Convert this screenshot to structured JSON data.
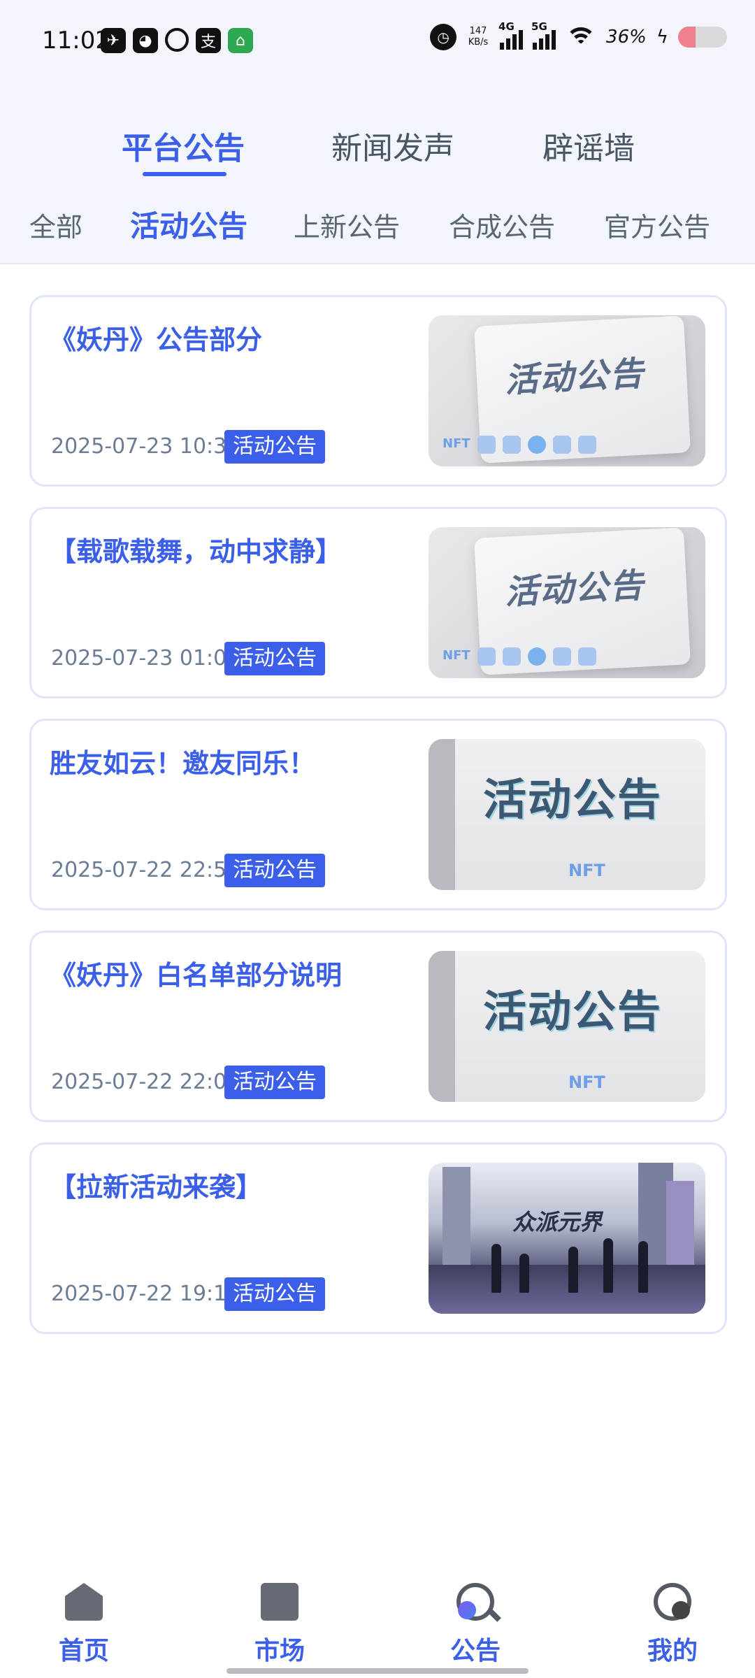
{
  "status_bar": {
    "time": "11:02",
    "app_icons": [
      "telegram-icon",
      "weibo-icon",
      "q-icon",
      "alipay-icon",
      "home-app-icon"
    ],
    "net_speed_value": "147",
    "net_speed_unit": "KB/s",
    "signal_labels": [
      "4G",
      "5G"
    ],
    "battery_text": "36%",
    "battery_level": 0.36
  },
  "main_tabs": [
    {
      "label": "平台公告",
      "active": true
    },
    {
      "label": "新闻发声",
      "active": false
    },
    {
      "label": "辟谣墙",
      "active": false
    }
  ],
  "sub_tabs": [
    {
      "label": "全部",
      "active": false
    },
    {
      "label": "活动公告",
      "active": true
    },
    {
      "label": "上新公告",
      "active": false
    },
    {
      "label": "合成公告",
      "active": false
    },
    {
      "label": "官方公告",
      "active": false
    }
  ],
  "announcements": [
    {
      "title": "《妖丹》公告部分",
      "date": "2025-07-23 10:30",
      "tag": "活动公告",
      "thumb_text": "活动公告",
      "thumb_nft": "NFT"
    },
    {
      "title": "【载歌载舞，动中求静】",
      "date": "2025-07-23 01:09",
      "tag": "活动公告",
      "thumb_text": "活动公告",
      "thumb_nft": "NFT"
    },
    {
      "title": "胜友如云！邀友同乐！",
      "date": "2025-07-22 22:53",
      "tag": "活动公告",
      "thumb_text": "活动公告",
      "thumb_nft": "NFT"
    },
    {
      "title": "《妖丹》白名单部分说明",
      "date": "2025-07-22 22:02",
      "tag": "活动公告",
      "thumb_text": "活动公告",
      "thumb_nft": "NFT"
    },
    {
      "title": "【拉新活动来袭】",
      "date": "2025-07-22 19:19",
      "tag": "活动公告",
      "thumb_text": "众派元界"
    }
  ],
  "bottom_nav": [
    {
      "label": "首页",
      "icon": "home-icon"
    },
    {
      "label": "市场",
      "icon": "market-icon"
    },
    {
      "label": "公告",
      "icon": "notice-icon",
      "active": true
    },
    {
      "label": "我的",
      "icon": "profile-icon"
    }
  ],
  "colors": {
    "accent": "#3b5fe8",
    "header_bg": "#f2f5fc",
    "card_border": "#dfe6fa",
    "date_text": "#6b7d94"
  }
}
